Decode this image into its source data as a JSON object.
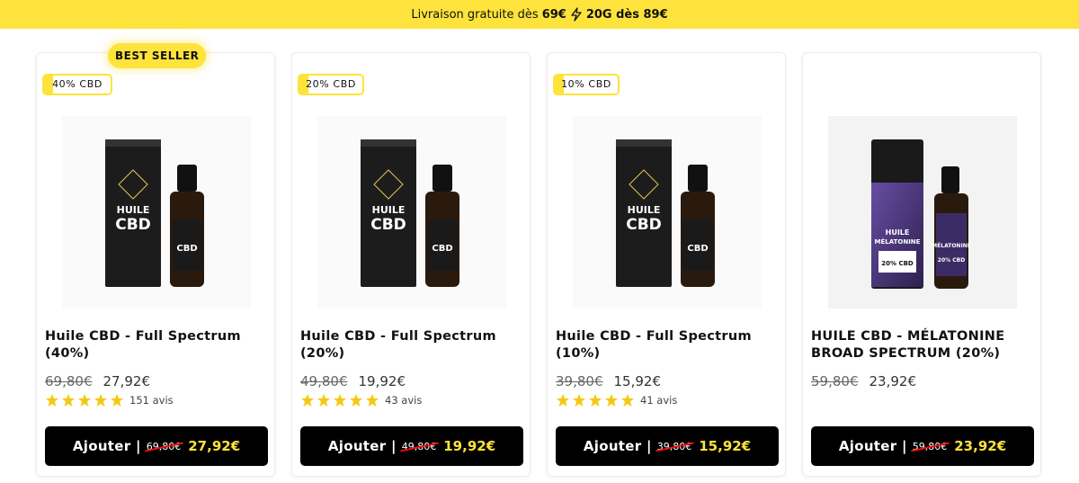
{
  "promo": {
    "text_before": "Livraison gratuite dès",
    "amount_1": "69€",
    "text_after": "20G dès 89€"
  },
  "badges": {
    "best_seller": "BEST SELLER"
  },
  "products": [
    {
      "tag": "40% CBD",
      "title": "Huile CBD - Full Spectrum (40%)",
      "old_price": "69,80€",
      "new_price": "27,92€",
      "rating": 5,
      "reviews": "151 avis",
      "button_label": "Ajouter |",
      "button_old_price": "69,80€",
      "button_new_price": "27,92€",
      "image_label": "huile-cbd-full-spectrum-bottle-icon"
    },
    {
      "tag": "20% CBD",
      "title": "Huile CBD - Full Spectrum (20%)",
      "old_price": "49,80€",
      "new_price": "19,92€",
      "rating": 5,
      "reviews": "43 avis",
      "button_label": "Ajouter |",
      "button_old_price": "49,80€",
      "button_new_price": "19,92€",
      "image_label": "huile-cbd-full-spectrum-bottle-icon"
    },
    {
      "tag": "10% CBD",
      "title": "Huile CBD - Full Spectrum (10%)",
      "old_price": "39,80€",
      "new_price": "15,92€",
      "rating": 5,
      "reviews": "41 avis",
      "button_label": "Ajouter |",
      "button_old_price": "39,80€",
      "button_new_price": "15,92€",
      "image_label": "huile-cbd-full-spectrum-bottle-icon"
    },
    {
      "tag": "",
      "title": "HUILE CBD - MÉLATONINE BROAD SPECTRUM (20%)",
      "old_price": "59,80€",
      "new_price": "23,92€",
      "rating": 0,
      "reviews": "",
      "button_label": "Ajouter |",
      "button_old_price": "59,80€",
      "button_new_price": "23,92€",
      "image_label": "huile-melatonine-bottle-icon"
    }
  ],
  "colors": {
    "accent": "#fde33b",
    "button": "#000000",
    "star": "#f6c814"
  }
}
